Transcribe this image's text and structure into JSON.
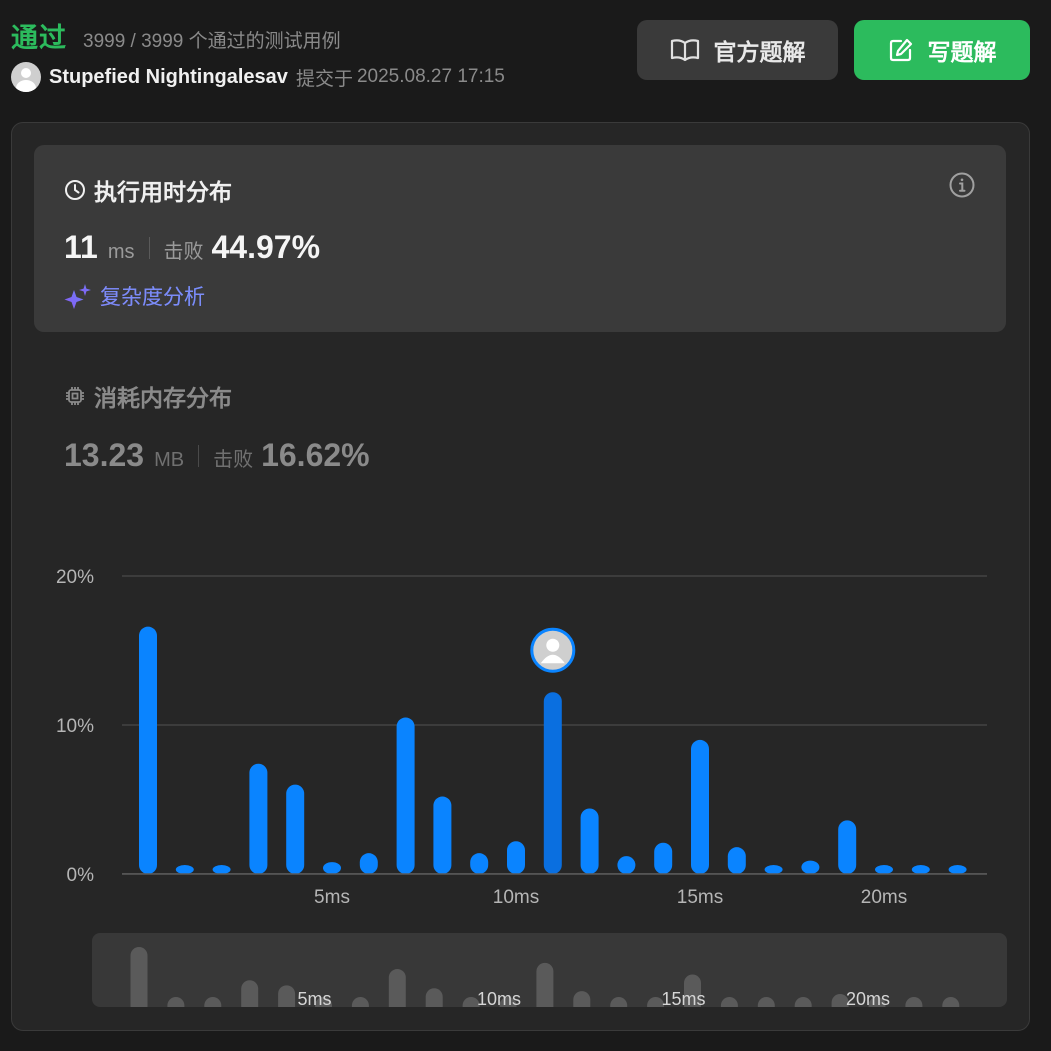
{
  "header": {
    "status": "通过",
    "cases": "3999 / 3999 个通过的测试用例",
    "username": "Stupefied Nightingalesav",
    "submit_prefix": "提交于",
    "submit_time": "2025.08.27 17:15",
    "official_solution_label": "官方题解",
    "write_solution_label": "写题解"
  },
  "runtime": {
    "title": "执行用时分布",
    "value": "11",
    "unit": "ms",
    "beats_label": "击败",
    "beats_value": "44.97%",
    "complexity_label": "复杂度分析"
  },
  "memory": {
    "title": "消耗内存分布",
    "value": "13.23",
    "unit": "MB",
    "beats_label": "击败",
    "beats_value": "16.62%"
  },
  "colors": {
    "accent_green": "#2cbb5d",
    "bar_blue": "#0a84ff",
    "bar_user": "#0a6fe0",
    "mini_bar": "#5a5a5a"
  },
  "chart_data": {
    "type": "bar",
    "x": [
      1,
      2,
      3,
      4,
      5,
      6,
      7,
      8,
      9,
      10,
      11,
      12,
      13,
      14,
      15,
      16,
      17,
      18,
      19,
      20,
      21,
      22,
      23
    ],
    "values": [
      16.6,
      0.6,
      0.6,
      7.4,
      6.0,
      0.8,
      1.4,
      10.5,
      5.2,
      1.4,
      2.2,
      12.2,
      4.4,
      1.2,
      2.1,
      9.0,
      1.8,
      0.6,
      0.9,
      3.6,
      0.6,
      0.6,
      0.6
    ],
    "x_tick_labels": [
      "5ms",
      "10ms",
      "15ms",
      "20ms"
    ],
    "x_tick_values": [
      6,
      11,
      16,
      21
    ],
    "y_tick_labels": [
      "20%",
      "10%",
      "0%"
    ],
    "y_tick_values": [
      20,
      10,
      0
    ],
    "ylim": [
      0,
      20
    ],
    "user_x": 12,
    "grid": true
  }
}
